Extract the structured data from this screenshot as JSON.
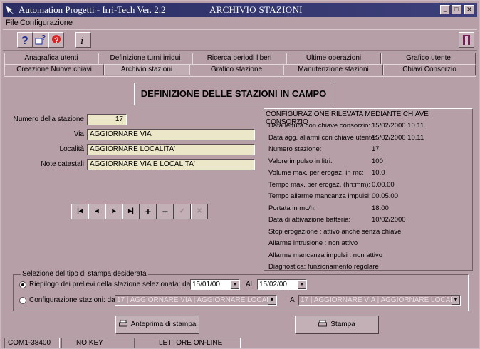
{
  "window": {
    "title_left": "Automation Progetti - Irri-Tech  Ver. 2.2",
    "title_center": "ARCHIVIO STAZIONI"
  },
  "menu": [
    "File",
    "Configurazione"
  ],
  "toolbar": {
    "icons": [
      "help-icon",
      "edit-icon",
      "hint-icon",
      "info-icon",
      "exit-door-icon"
    ]
  },
  "tabs": {
    "row1": [
      "Anagrafica utenti",
      "Definizione turni irrigui",
      "Ricerca periodi liberi",
      "Ultime operazioni",
      "Grafico utente"
    ],
    "row2": [
      "Creazione Nuove chiavi",
      "Archivio stazioni",
      "Grafico stazione",
      "Manutenzione stazioni",
      "Chiavi Consorzio"
    ],
    "active": "Archivio stazioni"
  },
  "heading": "DEFINIZIONE DELLE STAZIONI IN CAMPO",
  "form": {
    "numero_label": "Numero della stazione",
    "numero_value": "17",
    "via_label": "Via",
    "via_value": "AGGIORNARE VIA",
    "localita_label": "Località",
    "localita_value": "AGGIORNARE LOCALITA'",
    "note_label": "Note catastali",
    "note_value": "AGGIORNARE VIA E LOCALITA'"
  },
  "nav": {
    "first": "|◂",
    "prev": "◂",
    "next": "▸",
    "last": "▸|",
    "add": "+",
    "remove": "−",
    "confirm": "✓",
    "cancel": "✕"
  },
  "config": {
    "title": "CONFIGURAZIONE RILEVATA MEDIANTE CHIAVE CONSORZIO",
    "rows": [
      {
        "label": "Data lettura con chiave consorzio:",
        "value": "15/02/2000 10.11"
      },
      {
        "label": "Data agg. allarmi con chiave utente:",
        "value": "15/02/2000 10.11"
      },
      {
        "label": "Numero stazione:",
        "value": "17"
      },
      {
        "label": "Valore impulso in litri:",
        "value": "100"
      },
      {
        "label": "Volume max. per erogaz. in mc:",
        "value": "10.0"
      },
      {
        "label": "Tempo max. per erogaz. (hh:mm):",
        "value": "0.00.00"
      },
      {
        "label": "Tempo allarme mancanza impulsi:",
        "value": "00.05.00"
      },
      {
        "label": "Portata in mc/h:",
        "value": "18.00"
      },
      {
        "label": "Data di attivazione batteria:",
        "value": "10/02/2000"
      },
      {
        "label": "Stop erogazione : attivo anche senza chiave",
        "value": ""
      },
      {
        "label": "Allarme intrusione : non attivo",
        "value": ""
      },
      {
        "label": "Allarme mancanza impulsi : non attivo",
        "value": ""
      },
      {
        "label": "Diagnostica: funzionamento regolare",
        "value": ""
      }
    ]
  },
  "print": {
    "legend": "Selezione del tipo di stampa desiderata",
    "option1": "Riepilogo dei prelievi della stazione selezionata: dal",
    "date_from": "15/01/00",
    "al_label": "Al",
    "date_to": "15/02/00",
    "option2": "Configurazione stazioni: da",
    "da_value": "17 | AGGIORNARE VIA | AGGIORNARE LOCALI",
    "a_label": "A",
    "a_value": "17 | AGGIORNARE VIA | AGGIORNARE LOCALI",
    "preview_button": "Anteprima di stampa",
    "print_button": "Stampa"
  },
  "status": [
    "COM1-38400",
    "NO KEY",
    "LETTORE ON-LINE"
  ]
}
